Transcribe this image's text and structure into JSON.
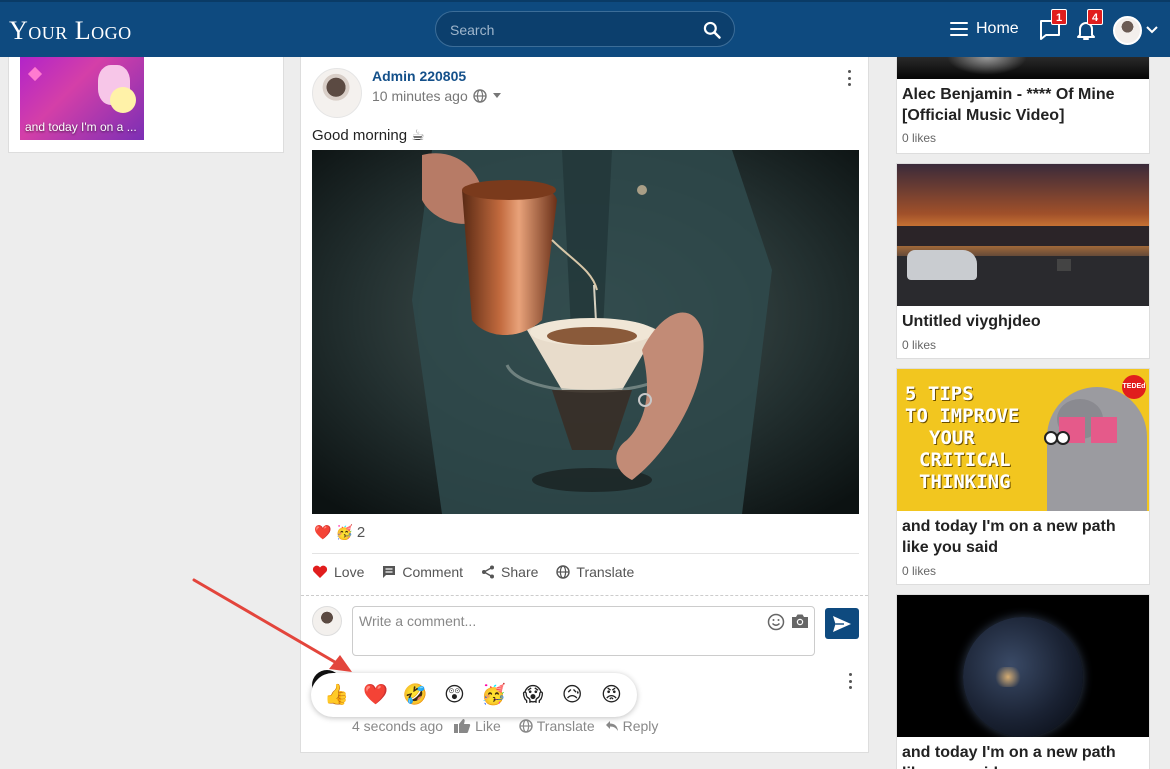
{
  "header": {
    "logo_text": "Your Logo",
    "search_placeholder": "Search",
    "home_label": "Home",
    "messages_count": "1",
    "notifications_count": "4"
  },
  "left": {
    "thumb_caption": "and today I'm on a ..."
  },
  "post": {
    "author": "Admin 220805",
    "time": "10 minutes ago",
    "text": "Good morning",
    "text_emoji": "☕",
    "reactions": {
      "icons": [
        "❤️",
        "🥳"
      ],
      "count": "2"
    },
    "actions": {
      "love": "Love",
      "comment": "Comment",
      "share": "Share",
      "translate": "Translate"
    },
    "comment_placeholder": "Write a comment...",
    "picker": [
      "👍",
      "❤️",
      "🤣",
      "😲",
      "🥳",
      "😱",
      "😥",
      "😡"
    ],
    "comment": {
      "time": "4 seconds ago",
      "like": "Like",
      "translate": "Translate",
      "reply": "Reply"
    }
  },
  "videos": [
    {
      "title": "Alec Benjamin - **** Of Mine [Official Music Video]",
      "likes": "0 likes"
    },
    {
      "title": "Untitled viyghjdeo",
      "likes": "0 likes"
    },
    {
      "title": "and today I'm on a new path like you said",
      "likes": "0 likes",
      "thumb_lines": [
        "5 TIPS",
        "TO IMPROVE",
        "YOUR",
        "CRITICAL",
        "THINKING"
      ],
      "thumb_badge": "TEDEd"
    },
    {
      "title": "and today I'm on a new path like you said"
    }
  ],
  "colors": {
    "brand": "#0e4a7f",
    "accent_red": "#e11d1d"
  }
}
